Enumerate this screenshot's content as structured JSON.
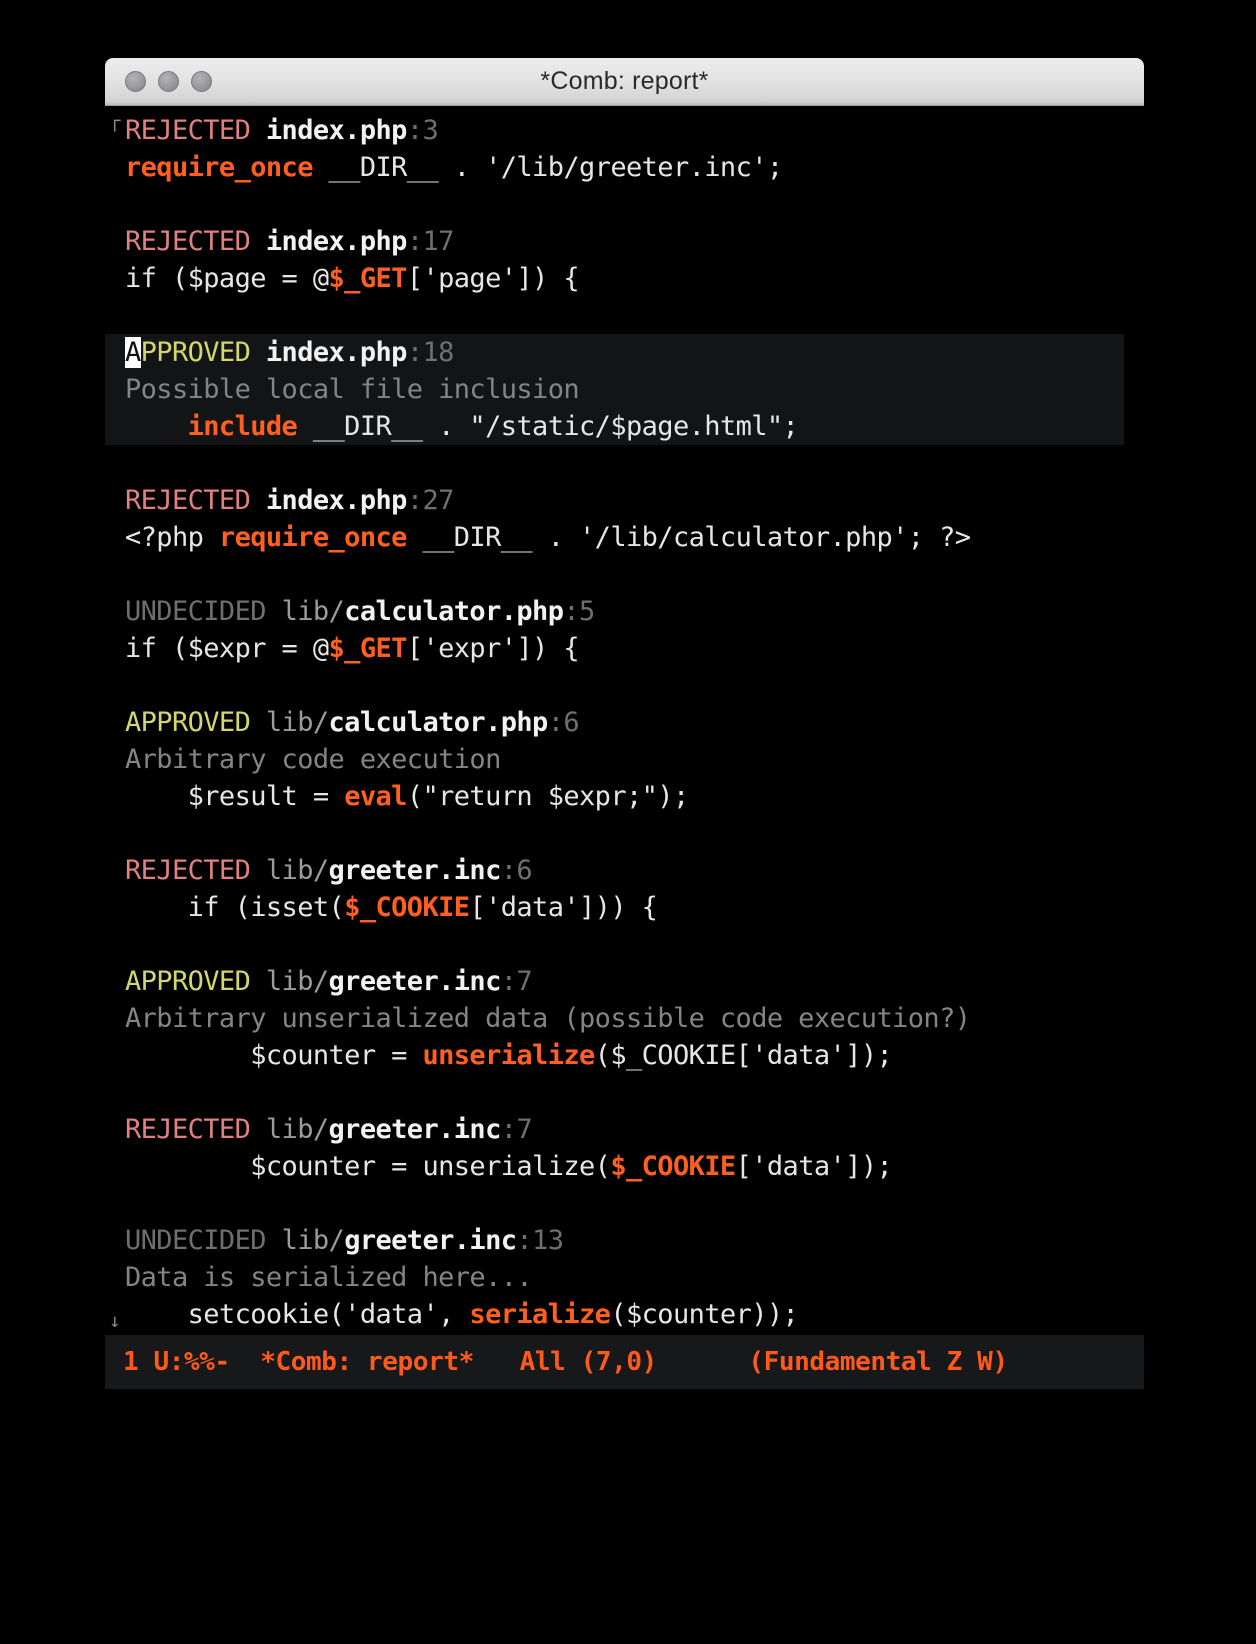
{
  "window": {
    "title": "*Comb: report*",
    "traffic_lights": [
      "close-button",
      "minimize-button",
      "zoom-button"
    ]
  },
  "fringe": {
    "top_marker": "┌",
    "bottom_marker": "↓"
  },
  "entries": [
    {
      "verdict": "REJECTED",
      "verdict_kind": "rejected",
      "dir": "",
      "file": "index.php",
      "sep": ":",
      "line": "3",
      "note": null,
      "highlighted": false,
      "cursor": false,
      "code": [
        {
          "t": "require_once",
          "c": "kw"
        },
        {
          "t": " __DIR__ . '/lib/greeter.inc';",
          "c": "plain"
        }
      ]
    },
    {
      "verdict": "REJECTED",
      "verdict_kind": "rejected",
      "dir": "",
      "file": "index.php",
      "sep": ":",
      "line": "17",
      "note": null,
      "highlighted": false,
      "cursor": false,
      "code": [
        {
          "t": "if ($page = @",
          "c": "plain"
        },
        {
          "t": "$_GET",
          "c": "kw"
        },
        {
          "t": "['page']) {",
          "c": "plain"
        }
      ]
    },
    {
      "verdict": "APPROVED",
      "verdict_kind": "approved",
      "dir": "",
      "file": "index.php",
      "sep": ":",
      "line": "18",
      "note": "Possible local file inclusion",
      "highlighted": true,
      "cursor": true,
      "code": [
        {
          "t": "    ",
          "c": "plain"
        },
        {
          "t": "include",
          "c": "kw"
        },
        {
          "t": " __DIR__ . \"/static/$page.html\";",
          "c": "plain"
        }
      ]
    },
    {
      "verdict": "REJECTED",
      "verdict_kind": "rejected",
      "dir": "",
      "file": "index.php",
      "sep": ":",
      "line": "27",
      "note": null,
      "highlighted": false,
      "cursor": false,
      "code": [
        {
          "t": "<?php ",
          "c": "plain"
        },
        {
          "t": "require_once",
          "c": "kw"
        },
        {
          "t": " __DIR__ . '/lib/calculator.php'; ?>",
          "c": "plain"
        }
      ]
    },
    {
      "verdict": "UNDECIDED",
      "verdict_kind": "undecided",
      "dir": "lib/",
      "file": "calculator.php",
      "sep": ":",
      "line": "5",
      "note": null,
      "highlighted": false,
      "cursor": false,
      "code": [
        {
          "t": "if ($expr = @",
          "c": "plain"
        },
        {
          "t": "$_GET",
          "c": "kw"
        },
        {
          "t": "['expr']) {",
          "c": "plain"
        }
      ]
    },
    {
      "verdict": "APPROVED",
      "verdict_kind": "approved",
      "dir": "lib/",
      "file": "calculator.php",
      "sep": ":",
      "line": "6",
      "note": "Arbitrary code execution",
      "highlighted": false,
      "cursor": false,
      "code": [
        {
          "t": "    $result = ",
          "c": "plain"
        },
        {
          "t": "eval",
          "c": "kw"
        },
        {
          "t": "(\"return $expr;\");",
          "c": "plain"
        }
      ]
    },
    {
      "verdict": "REJECTED",
      "verdict_kind": "rejected",
      "dir": "lib/",
      "file": "greeter.inc",
      "sep": ":",
      "line": "6",
      "note": null,
      "highlighted": false,
      "cursor": false,
      "code": [
        {
          "t": "    if (isset(",
          "c": "plain"
        },
        {
          "t": "$_COOKIE",
          "c": "kw"
        },
        {
          "t": "['data'])) {",
          "c": "plain"
        }
      ]
    },
    {
      "verdict": "APPROVED",
      "verdict_kind": "approved",
      "dir": "lib/",
      "file": "greeter.inc",
      "sep": ":",
      "line": "7",
      "note": "Arbitrary unserialized data (possible code execution?)",
      "highlighted": false,
      "cursor": false,
      "code": [
        {
          "t": "        $counter = ",
          "c": "plain"
        },
        {
          "t": "unserialize",
          "c": "kw"
        },
        {
          "t": "($_COOKIE['data']);",
          "c": "plain"
        }
      ]
    },
    {
      "verdict": "REJECTED",
      "verdict_kind": "rejected",
      "dir": "lib/",
      "file": "greeter.inc",
      "sep": ":",
      "line": "7",
      "note": null,
      "highlighted": false,
      "cursor": false,
      "code": [
        {
          "t": "        $counter = unserialize(",
          "c": "plain"
        },
        {
          "t": "$_COOKIE",
          "c": "kw"
        },
        {
          "t": "['data']);",
          "c": "plain"
        }
      ]
    },
    {
      "verdict": "UNDECIDED",
      "verdict_kind": "undecided",
      "dir": "lib/",
      "file": "greeter.inc",
      "sep": ":",
      "line": "13",
      "note": "Data is serialized here...",
      "highlighted": false,
      "cursor": false,
      "code": [
        {
          "t": "    setcookie('data', ",
          "c": "plain"
        },
        {
          "t": "serialize",
          "c": "kw"
        },
        {
          "t": "($counter));",
          "c": "plain"
        }
      ]
    }
  ],
  "modeline": {
    "text": "1 U:%%-  *Comb: report*   All (7,0)      (Fundamental Z W)",
    "coding": "1 U:%%-",
    "buffer_name": "*Comb: report*",
    "position": "All (7,0)",
    "modes": "(Fundamental Z W)"
  },
  "colors": {
    "background": "#000000",
    "highlight_background": "#131416",
    "rejected": "#e08080",
    "approved": "#d4d76e",
    "undecided": "#6f6f6f",
    "keyword": "#ff5f1f",
    "note": "#848484",
    "modeline_fg": "#ff5a1a",
    "modeline_bg": "#17181a"
  }
}
